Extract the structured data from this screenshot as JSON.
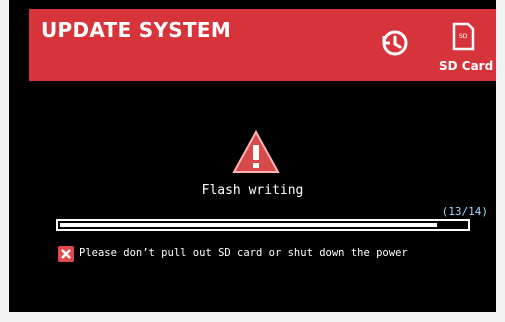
{
  "header": {
    "title": "UPDATE SYSTEM",
    "history_icon": "history-icon",
    "sd_icon": "sd-card-icon",
    "sd_label": "SD Card",
    "color": "#d6333a"
  },
  "status": {
    "message": "Flash writing",
    "warning_icon": "warning-triangle-icon"
  },
  "progress": {
    "count_text": "(13/14)",
    "current": 13,
    "total": 14
  },
  "notice": {
    "icon": "close-x-icon",
    "text": "Please don’t pull out SD card or shut down the power"
  }
}
